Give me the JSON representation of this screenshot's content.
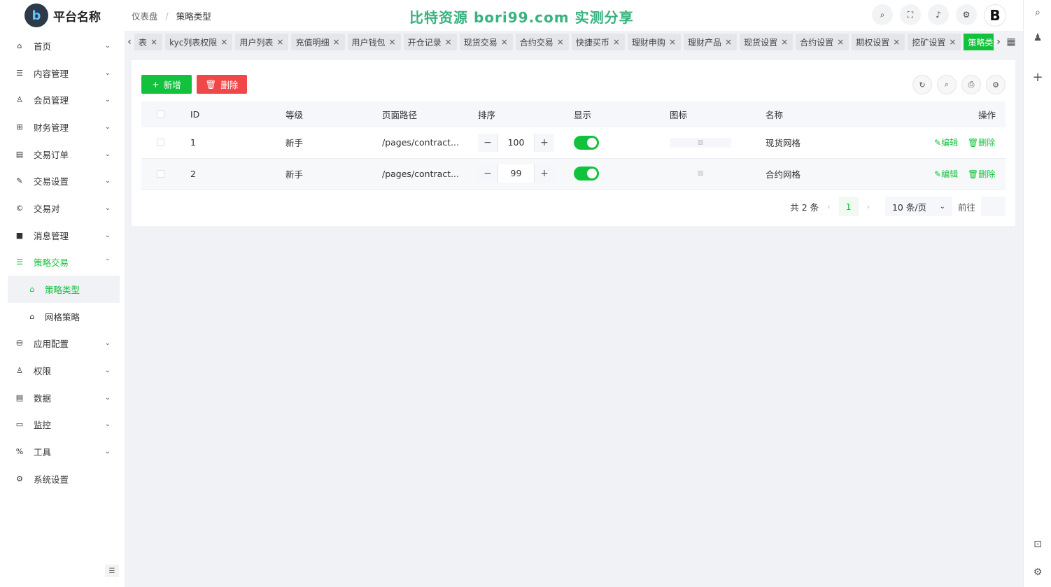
{
  "app": {
    "name": "平台名称",
    "logo_letter": "b"
  },
  "breadcrumb": {
    "home": "仪表盘",
    "current": "策略类型"
  },
  "watermark": "比特资源 bori99.com 实测分享",
  "avatar_letter": "B",
  "sidebar": {
    "items": [
      {
        "label": "首页",
        "icon": "⌂"
      },
      {
        "label": "内容管理",
        "icon": "☰"
      },
      {
        "label": "会员管理",
        "icon": "♙"
      },
      {
        "label": "财务管理",
        "icon": "⊞"
      },
      {
        "label": "交易订单",
        "icon": "▤"
      },
      {
        "label": "交易设置",
        "icon": "✎"
      },
      {
        "label": "交易对",
        "icon": "©"
      },
      {
        "label": "消息管理",
        "icon": "■"
      },
      {
        "label": "策略交易",
        "icon": "☰"
      }
    ],
    "sub_items": [
      {
        "label": "策略类型",
        "icon": "⌂"
      },
      {
        "label": "网格策略",
        "icon": "⌂"
      }
    ],
    "items_after": [
      {
        "label": "应用配置",
        "icon": "⛁"
      },
      {
        "label": "权限",
        "icon": "♙"
      },
      {
        "label": "数据",
        "icon": "▤"
      },
      {
        "label": "监控",
        "icon": "▭"
      },
      {
        "label": "工具",
        "icon": "%"
      },
      {
        "label": "系统设置",
        "icon": "⚙"
      }
    ]
  },
  "tags": [
    "表",
    "kyc列表权限",
    "用户列表",
    "充值明细",
    "用户钱包",
    "开仓记录",
    "现货交易",
    "合约交易",
    "快捷买币",
    "理财申购",
    "理财产品",
    "现货设置",
    "合约设置",
    "期权设置",
    "挖矿设置",
    "策略类型"
  ],
  "toolbar": {
    "add_label": "新增",
    "delete_label": "删除"
  },
  "table": {
    "headers": [
      "ID",
      "等级",
      "页面路径",
      "排序",
      "显示",
      "图标",
      "名称",
      "操作"
    ],
    "rows": [
      {
        "id": "1",
        "level": "新手",
        "path": "/pages/contract...",
        "sort": "100",
        "name": "现货网格",
        "edit": "编辑",
        "delete": "删除"
      },
      {
        "id": "2",
        "level": "新手",
        "path": "/pages/contract...",
        "sort": "99",
        "name": "合约网格",
        "edit": "编辑",
        "delete": "删除"
      }
    ]
  },
  "pager": {
    "total": "共 2 条",
    "current": "1",
    "size": "10 条/页",
    "goto": "前往"
  },
  "colors": {
    "primary": "#13c23c",
    "danger": "#f04848"
  }
}
